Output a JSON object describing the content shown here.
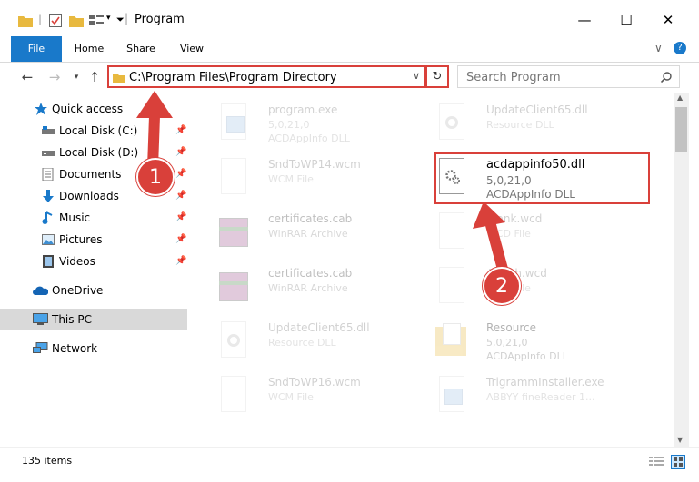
{
  "window": {
    "title": "Program",
    "controls": [
      "—",
      "☐",
      "✕"
    ]
  },
  "ribbon": {
    "tabs": [
      "File",
      "Home",
      "Share",
      "View"
    ],
    "help": "?",
    "expand": "∨"
  },
  "address_bar": {
    "path": "C:\\Program Files\\Program Directory",
    "search_placeholder": "Search Program"
  },
  "nav_pane": {
    "items": [
      {
        "label": "Quick access",
        "icon": "star-icon",
        "pinned": false
      },
      {
        "label": "Local Disk (C:)",
        "icon": "drive-icon",
        "pinned": true
      },
      {
        "label": "Local Disk (D:)",
        "icon": "drive-icon",
        "pinned": true
      },
      {
        "label": "Documents",
        "icon": "documents-icon",
        "pinned": true
      },
      {
        "label": "Downloads",
        "icon": "download-icon",
        "pinned": true
      },
      {
        "label": "Music",
        "icon": "music-icon",
        "pinned": true
      },
      {
        "label": "Pictures",
        "icon": "pictures-icon",
        "pinned": true
      },
      {
        "label": "Videos",
        "icon": "videos-icon",
        "pinned": true
      },
      {
        "label": "OneDrive",
        "icon": "cloud-icon",
        "pinned": false
      },
      {
        "label": "This PC",
        "icon": "computer-icon",
        "pinned": false,
        "selected": true
      },
      {
        "label": "Network",
        "icon": "network-icon",
        "pinned": false
      }
    ]
  },
  "files": [
    {
      "name": "program.exe",
      "meta1": "5,0,21,0",
      "meta2": "ACDAppInfo DLL",
      "icon": "installer-icon",
      "faded": true
    },
    {
      "name": "UpdateClient65.dll",
      "meta1": "Resource DLL",
      "meta2": "",
      "icon": "dll-icon",
      "faded": true
    },
    {
      "name": "SndToWP14.wcm",
      "meta1": "WCM File",
      "meta2": "",
      "icon": "blank-file-icon",
      "faded": true
    },
    {
      "name": "acdappinfo50.dll",
      "meta1": "5,0,21,0",
      "meta2": "ACDAppInfo DLL",
      "icon": "dll-gear-icon",
      "faded": false,
      "highlighted": true
    },
    {
      "name": "certificates.cab",
      "meta1": "WinRAR Archive",
      "meta2": "",
      "icon": "winrar-icon",
      "faded": true
    },
    {
      "name": "Blank.wcd",
      "meta1": "WCD File",
      "meta2": "",
      "icon": "blank-file-icon",
      "faded": true
    },
    {
      "name": "certificates.cab",
      "meta1": "WinRAR Archive",
      "meta2": "",
      "icon": "winrar-icon",
      "faded": true
    },
    {
      "name": "Attach.wcd",
      "meta1": "WCD File",
      "meta2": "",
      "icon": "blank-file-icon",
      "faded": true
    },
    {
      "name": "UpdateClient65.dll",
      "meta1": "Resource DLL",
      "meta2": "",
      "icon": "dll-icon",
      "faded": true
    },
    {
      "name": "Resource",
      "meta1": "5,0,21,0",
      "meta2": "ACDAppInfo DLL",
      "icon": "folder-icon",
      "faded": true
    },
    {
      "name": "SndToWP16.wcm",
      "meta1": "WCM File",
      "meta2": "",
      "icon": "blank-file-icon",
      "faded": true
    },
    {
      "name": "TrigrammInstaller.exe",
      "meta1": "ABBYY fineReader 1...",
      "meta2": "",
      "icon": "installer-icon",
      "faded": true
    }
  ],
  "status": {
    "item_count": "135 items"
  },
  "annotations": {
    "callout_1": "1",
    "callout_2": "2",
    "accent_color": "#d9403a"
  }
}
